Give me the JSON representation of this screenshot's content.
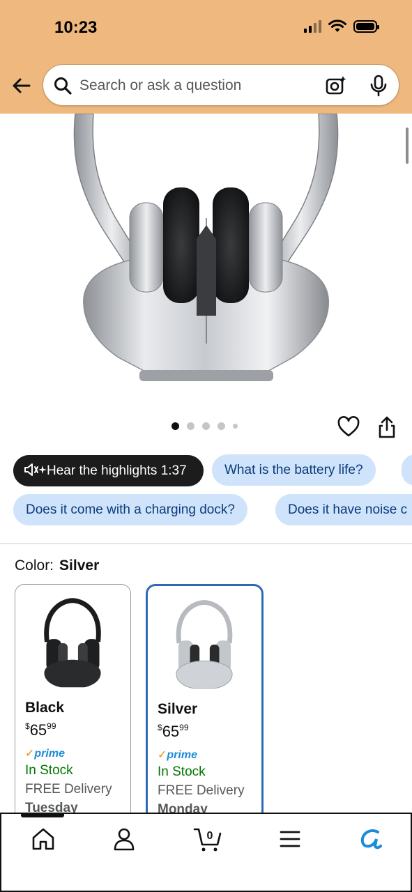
{
  "status_bar": {
    "time": "10:23"
  },
  "search": {
    "placeholder": "Search or ask a question"
  },
  "gallery": {
    "total_images": 5,
    "active_index": 0
  },
  "chips": {
    "hear_highlights": "Hear the highlights 1:37",
    "q1": "What is the battery life?",
    "q2": "Does it come with a charging dock?",
    "q3": "Does it have noise c"
  },
  "color": {
    "label": "Color:",
    "selected": "Silver"
  },
  "variants": [
    {
      "name": "Black",
      "price_symbol": "$",
      "price_whole": "65",
      "price_fraction": "99",
      "prime": "prime",
      "stock": "In Stock",
      "delivery": "FREE Delivery",
      "day": "Tuesday",
      "selected": false
    },
    {
      "name": "Silver",
      "price_symbol": "$",
      "price_whole": "65",
      "price_fraction": "99",
      "prime": "prime",
      "stock": "In Stock",
      "delivery": "FREE Delivery",
      "day": "Monday",
      "selected": true
    }
  ],
  "bottom_nav": [
    "home-icon",
    "account-icon",
    "cart-icon",
    "menu-icon",
    "rufus-icon"
  ],
  "bottom_nav_cart_count": "0",
  "colors": {
    "header": "#efb87f",
    "chip_blue": "#cfe3fb",
    "selected_border": "#2c6bb4",
    "in_stock": "#007600",
    "prime": "#1a8cd8"
  }
}
